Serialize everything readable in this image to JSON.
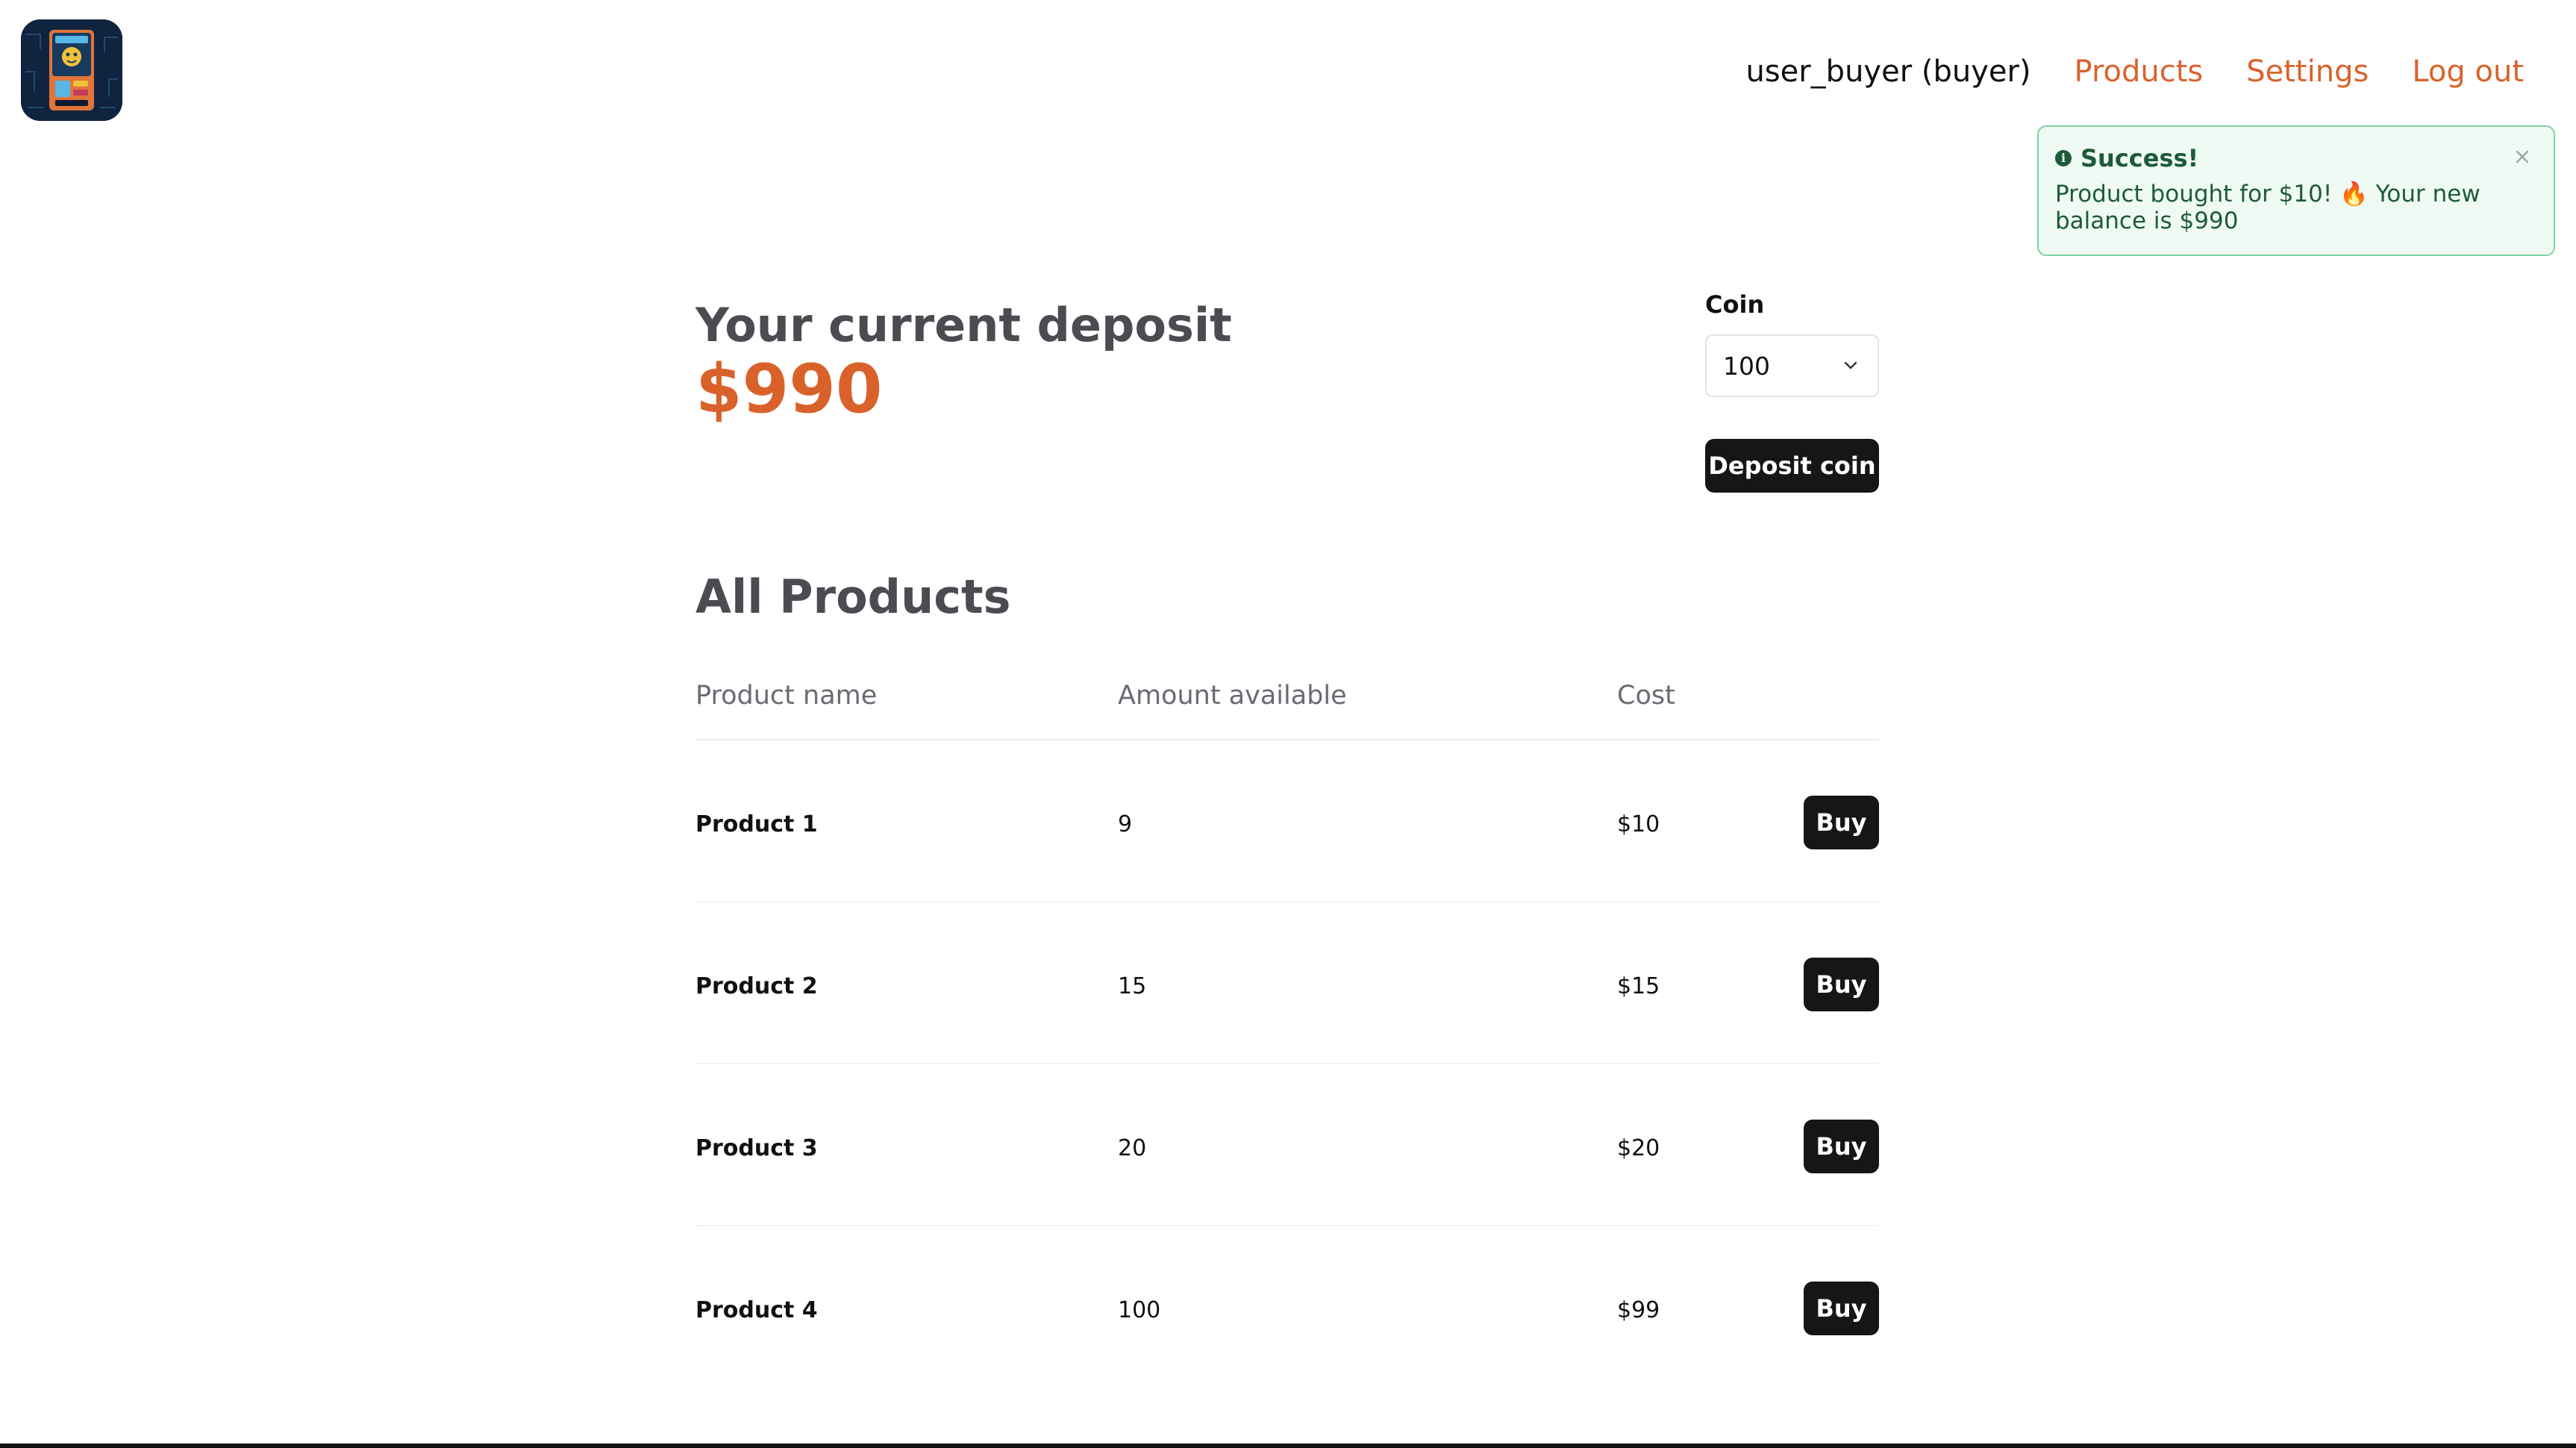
{
  "header": {
    "logo_icon": "vending-machine-logo-icon",
    "user_label": "user_buyer (buyer)",
    "nav": [
      {
        "label": "Products"
      },
      {
        "label": "Settings"
      },
      {
        "label": "Log out"
      }
    ],
    "accent_color": "#d9622b"
  },
  "toast": {
    "title": "Success!",
    "message": "Product bought for $10! 🔥 Your new balance is $990",
    "icon": "info-icon",
    "close_icon": "close-icon",
    "color": "#1d5a3a"
  },
  "deposit": {
    "label": "Your current deposit",
    "value": "$990",
    "coin_label": "Coin",
    "coin_selected": "100",
    "deposit_button": "Deposit coin"
  },
  "products": {
    "title": "All Products",
    "columns": [
      "Product name",
      "Amount available",
      "Cost"
    ],
    "buy_label": "Buy",
    "rows": [
      {
        "name": "Product 1",
        "amount": "9",
        "cost": "$10"
      },
      {
        "name": "Product 2",
        "amount": "15",
        "cost": "$15"
      },
      {
        "name": "Product 3",
        "amount": "20",
        "cost": "$20"
      },
      {
        "name": "Product 4",
        "amount": "100",
        "cost": "$99"
      }
    ]
  }
}
